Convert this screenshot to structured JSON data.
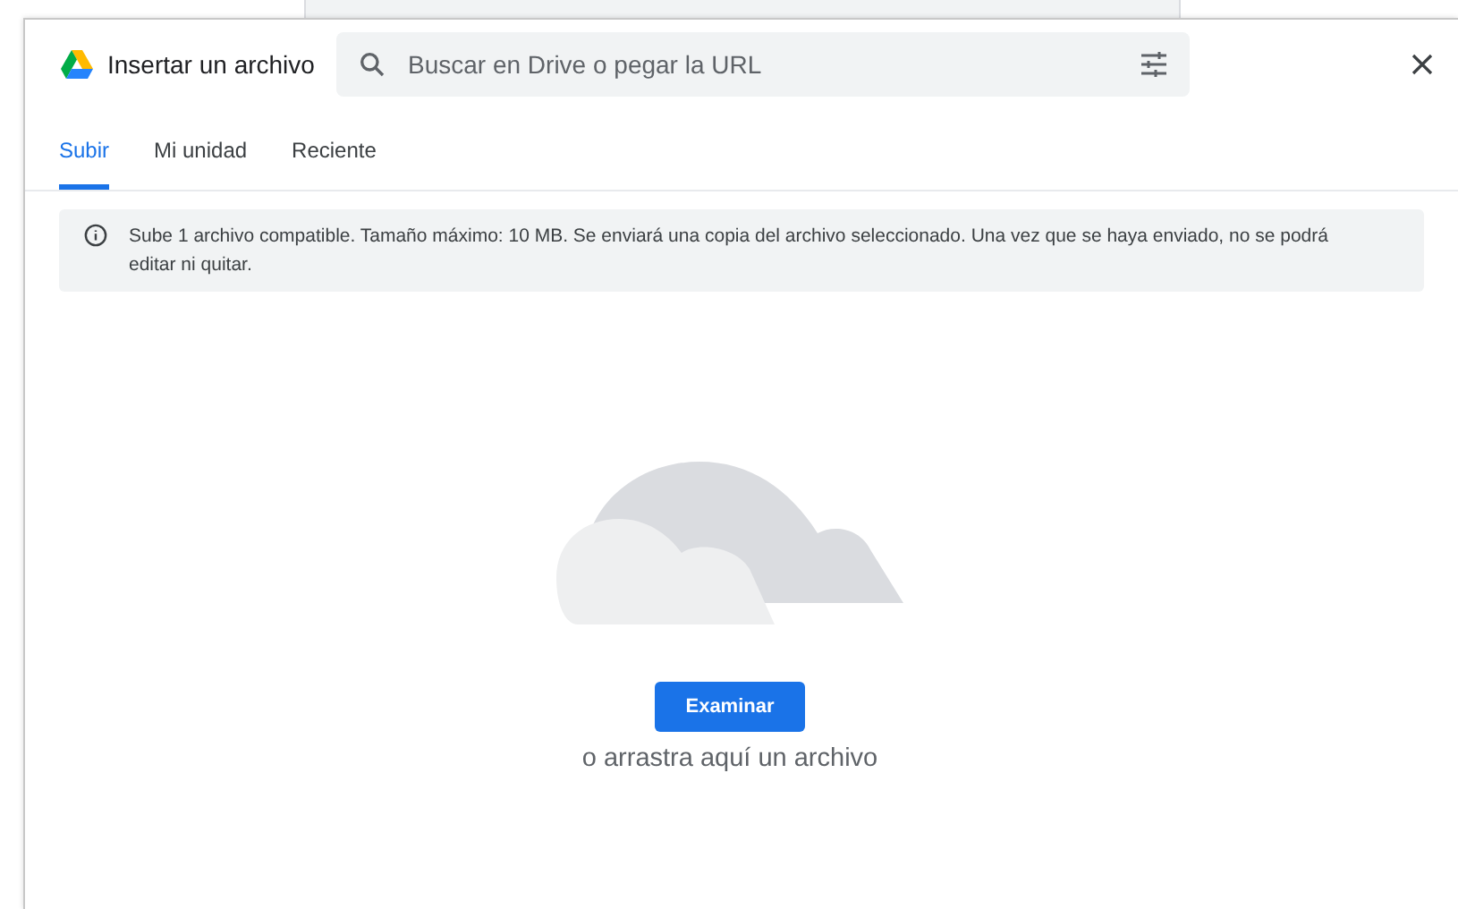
{
  "dialog": {
    "title": "Insertar un archivo"
  },
  "search": {
    "placeholder": "Buscar en Drive o pegar la URL"
  },
  "tabs": [
    {
      "label": "Subir",
      "selected": true
    },
    {
      "label": "Mi unidad",
      "selected": false
    },
    {
      "label": "Reciente",
      "selected": false
    }
  ],
  "notice": "Sube 1 archivo compatible. Tamaño máximo: 10 MB. Se enviará una copia del archivo seleccionado. Una vez que se haya enviado, no se podrá editar ni quitar.",
  "upload": {
    "button": "Examinar",
    "hint": "o arrastra aquí un archivo"
  }
}
